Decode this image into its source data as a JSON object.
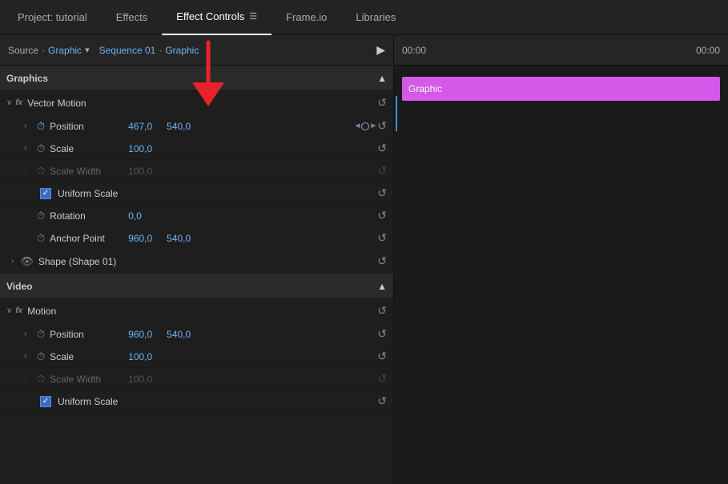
{
  "tabs": [
    {
      "label": "Project: tutorial",
      "active": false
    },
    {
      "label": "Effects",
      "active": false
    },
    {
      "label": "Effect Controls",
      "active": true
    },
    {
      "label": "Frame.io",
      "active": false
    },
    {
      "label": "Libraries",
      "active": false
    }
  ],
  "source": {
    "label": "Source",
    "dot": "·",
    "source_name": "Graphic",
    "sequence": "Sequence 01",
    "clip": "Graphic"
  },
  "sections": {
    "graphics": {
      "title": "Graphics",
      "fx_label": "fx",
      "fx_name": "Vector Motion",
      "properties": [
        {
          "name": "Position",
          "value1": "467,0",
          "value2": "540,0",
          "has_keyframe": true,
          "expand": true,
          "icon": "stopwatch"
        },
        {
          "name": "Scale",
          "value1": "100,0",
          "value2": null,
          "has_keyframe": false,
          "expand": true,
          "icon": "stopwatch"
        },
        {
          "name": "Scale Width",
          "value1": "100,0",
          "value2": null,
          "has_keyframe": false,
          "expand": false,
          "dim": true,
          "icon": "stopwatch"
        },
        {
          "name": "uniform_scale",
          "type": "checkbox",
          "label": "Uniform Scale",
          "checked": true
        },
        {
          "name": "Rotation",
          "value1": "0,0",
          "value2": null,
          "has_keyframe": false,
          "expand": false,
          "icon": "stopwatch"
        },
        {
          "name": "Anchor Point",
          "value1": "960,0",
          "value2": "540,0",
          "has_keyframe": false,
          "expand": false,
          "icon": "stopwatch"
        }
      ],
      "shape": "Shape (Shape 01)"
    },
    "video": {
      "title": "Video",
      "fx_label": "fx",
      "fx_name": "Motion",
      "properties": [
        {
          "name": "Position",
          "value1": "960,0",
          "value2": "540,0",
          "has_keyframe": false,
          "expand": true,
          "icon": "stopwatch"
        },
        {
          "name": "Scale",
          "value1": "100,0",
          "value2": null,
          "has_keyframe": false,
          "expand": true,
          "icon": "stopwatch"
        },
        {
          "name": "Scale Width",
          "value1": "100,0",
          "value2": null,
          "has_keyframe": false,
          "expand": false,
          "dim": true,
          "icon": "stopwatch"
        },
        {
          "name": "uniform_scale",
          "type": "checkbox",
          "label": "Uniform Scale",
          "checked": true
        }
      ]
    }
  },
  "timeline": {
    "time_start": "00:00",
    "time_end": "00:00",
    "graphic_bar_label": "Graphic"
  }
}
